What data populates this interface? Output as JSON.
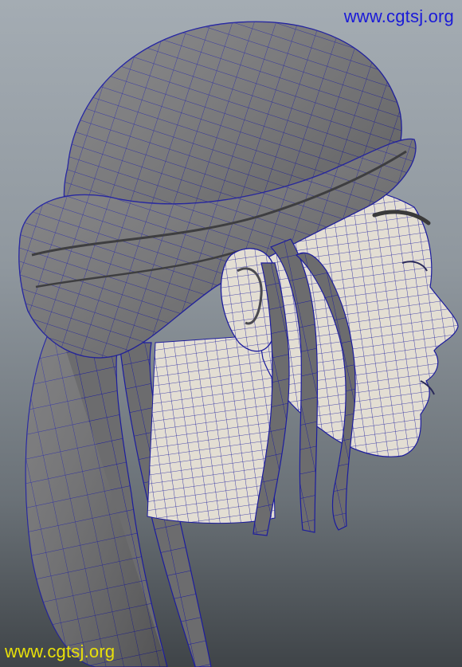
{
  "watermark_top": {
    "text": "www.cgtsj.org",
    "color": "#1a1ad8"
  },
  "watermark_bottom": {
    "text": "www.cgtsj.org",
    "color": "#e8e00a"
  },
  "colors": {
    "background_top": "#a4acb3",
    "background_bottom": "#3f4448",
    "hair_shade": "#6e6e70",
    "skin_shade": "#e3ded3",
    "wireframe": "#1c1c9e"
  }
}
